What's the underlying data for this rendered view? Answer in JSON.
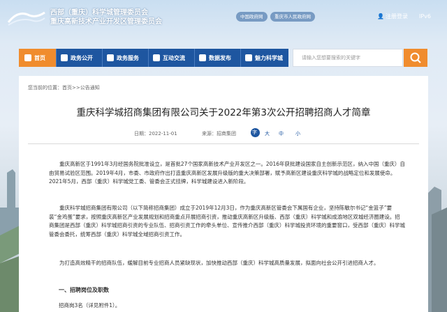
{
  "header": {
    "title_line1": "西部（重庆）科学城管理委员会",
    "title_line2": "重庆高新技术产业开发区管理委员会",
    "links": [
      "中国政府网",
      "重庆市人民政府网"
    ],
    "register": "注册",
    "login": "登录",
    "ipv6": "IPv6"
  },
  "nav": {
    "items": [
      {
        "label": "首页",
        "icon": "home-icon"
      },
      {
        "label": "政务公开",
        "icon": "doc-icon"
      },
      {
        "label": "政务服务",
        "icon": "service-icon"
      },
      {
        "label": "互动交流",
        "icon": "chat-icon"
      },
      {
        "label": "数据发布",
        "icon": "chart-icon"
      },
      {
        "label": "魅力科学城",
        "icon": "city-icon"
      }
    ]
  },
  "search": {
    "placeholder": "请输入您想要搜索的关键字"
  },
  "breadcrumb": "您当前的位置：首页>>公告通知",
  "article": {
    "title": "重庆科学城招商集团有限公司关于2022年第3次公开招聘招商人才简章",
    "date": "日期：2022-11-01",
    "source": "来源：招商集团",
    "font_label": "字",
    "font_sizes": [
      "大",
      "中",
      "小"
    ],
    "paragraphs": [
      "重庆高新区于1991年3月经国务院批准设立，是首批27个国家高新技术产业开发区之一。2016年获批建设国家自主创新示范区，纳入中国（重庆）自由贸易试验区范围。2019年4月，市委、市政府作出打造重庆高新区发展升级版的重大决策部署，赋予高新区建设重庆科学城的战略定位和发展使命。2021年5月，西部（重庆）科学城党工委、管委会正式挂牌，科学城建设进入新阶段。",
      "重庆科学城招商集团有限公司（以下简称招商集团）成立于2019年12月3日，作为重庆高新区管委会下属国有企业，坚持陈敏尔书记“金篮子”要装“金鸡蛋”要求，按照重庆高新区产业发展规划和招商重点开展招商引资，推动重庆高新区升级版、西部（重庆）科学城和成渝地区双城经济圈建设。招商集团是西部（重庆）科学城招商引资的专业队伍、招商引资工作的牵头单位、宣传推介西部（重庆）科学城投资环境的重要窗口，受西部（重庆）科学城管委会委托，统筹西部（重庆）科学城全域招商引资工作。",
      "为打造高效精干的招商队伍，缓解目前专业招商人员紧缺现状，加快推动西部（重庆）科学城高质量发展，拟面向社会公开引进招商人才。"
    ],
    "section_heading": "一、招聘岗位及职数",
    "last_line": "招商岗3名（详见附件1）。"
  },
  "colors": {
    "nav_blue": "#1e56a0",
    "accent_orange": "#f08c2e"
  }
}
